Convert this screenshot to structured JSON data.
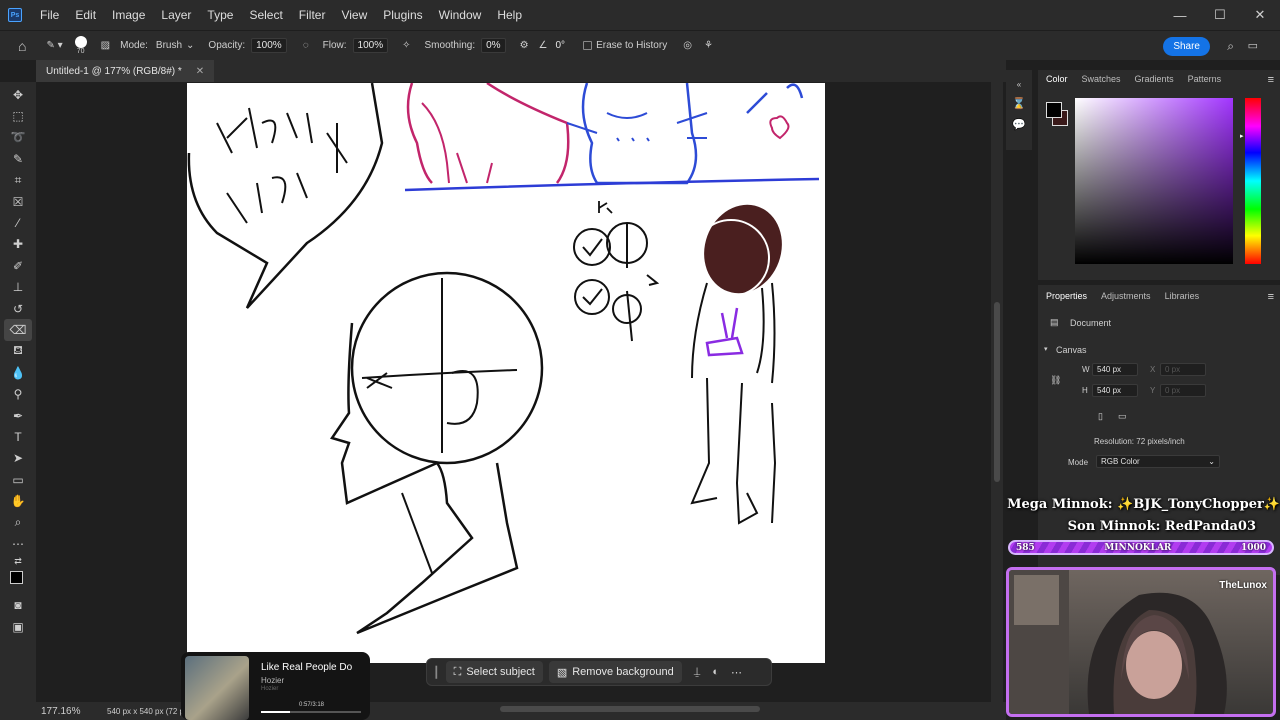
{
  "app": {
    "logo": "Ps",
    "menu": [
      "File",
      "Edit",
      "Image",
      "Layer",
      "Type",
      "Select",
      "Filter",
      "View",
      "Plugins",
      "Window",
      "Help"
    ],
    "window_buttons": [
      "minimize-icon",
      "maximize-icon",
      "close-icon"
    ]
  },
  "options": {
    "brush_size": "70",
    "mode_label": "Mode:",
    "mode_value": "Brush",
    "opacity_label": "Opacity:",
    "opacity_value": "100%",
    "flow_label": "Flow:",
    "flow_value": "100%",
    "smoothing_label": "Smoothing:",
    "smoothing_value": "0%",
    "angle_value": "0°",
    "erase_history_label": "Erase to History",
    "share_label": "Share"
  },
  "document": {
    "tab_title": "Untitled-1 @ 177% (RGB/8#) *",
    "zoom": "177.16%",
    "doc_info": "540 px x 540 px (72 ppi)"
  },
  "context_bar": {
    "select_subject": "Select subject",
    "remove_background": "Remove background"
  },
  "music": {
    "title": "Like Real People Do",
    "artist": "Hozier",
    "album": "Hozier",
    "time": "0:57/3:18",
    "progress": 0.29
  },
  "color_panel": {
    "tabs": [
      "Color",
      "Swatches",
      "Gradients",
      "Patterns"
    ],
    "foreground": "#000000",
    "background": "#3a1a1a"
  },
  "properties": {
    "tabs": [
      "Properties",
      "Adjustments",
      "Libraries"
    ],
    "document_label": "Document",
    "canvas_label": "Canvas",
    "w_label": "W",
    "w_value": "540 px",
    "h_label": "H",
    "h_value": "540 px",
    "x_label": "X",
    "y_label": "Y",
    "x_value": "0 px",
    "y_value": "0 px",
    "resolution": "Resolution: 72 pixels/inch",
    "mode_label": "Mode",
    "mode_value": "RGB Color"
  },
  "stream": {
    "mega_minnok": "Mega Minnok: ✨BJK_TonyChopper✨",
    "son_minnok": "Son Minnok: RedPanda03",
    "bar_current": "585",
    "bar_label": "MINNOKLAR",
    "bar_goal": "1000",
    "streamer_name": "TheLunox"
  }
}
